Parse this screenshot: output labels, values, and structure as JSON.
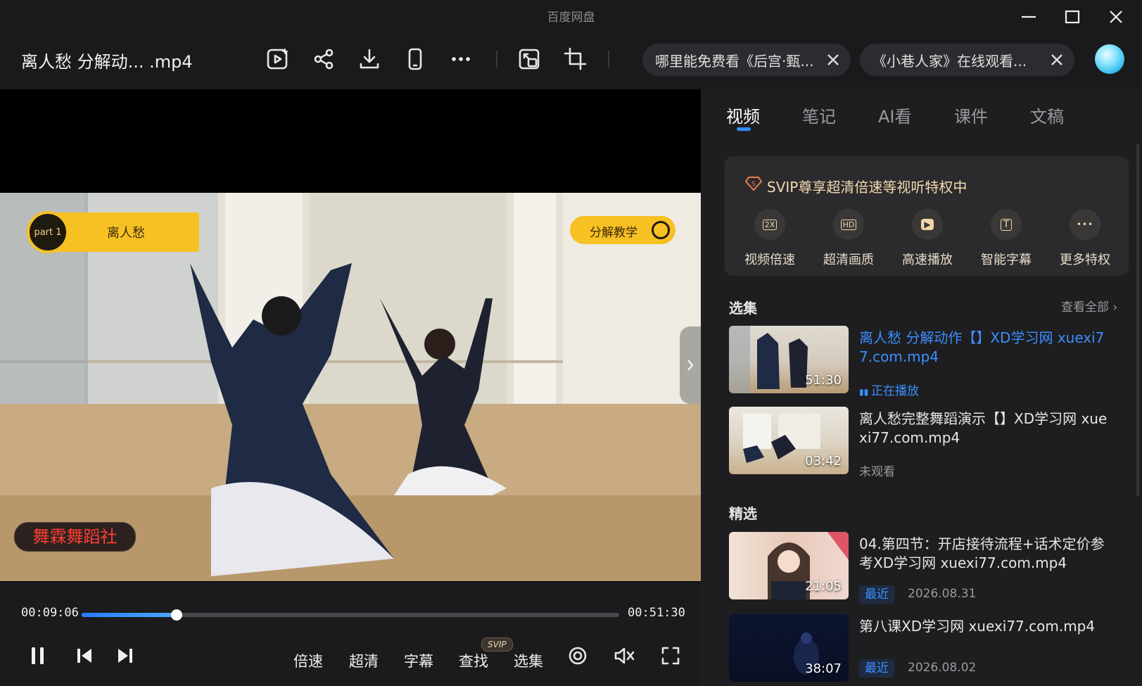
{
  "window": {
    "title": "百度网盘"
  },
  "file": {
    "title": "离人愁 分解动... .mp4"
  },
  "toolbar": {
    "icons": [
      "play-add-icon",
      "share-icon",
      "download-icon",
      "phone-icon",
      "more-icon",
      "screen-cast-icon",
      "crop-icon"
    ]
  },
  "browser_tabs": [
    {
      "label": "哪里能免费看《后宫·甄..."
    },
    {
      "label": "《小巷人家》在线观看..."
    }
  ],
  "video": {
    "overlay_part": "part 1",
    "overlay_title": "离人愁",
    "overlay_right": "分解教学",
    "watermark": "舞霖舞蹈社"
  },
  "player": {
    "current_time": "00:09:06",
    "total_time": "00:51:30",
    "progress": 0.1767,
    "speed_label": "倍速",
    "quality_label": "超清",
    "subtitle_label": "字幕",
    "search_label": "查找",
    "search_badge": "SVIP",
    "episodes_label": "选集"
  },
  "panel": {
    "tabs": [
      "视频",
      "笔记",
      "AI看",
      "课件",
      "文稿"
    ],
    "active_tab": 0,
    "svip": {
      "title": "SVIP尊享超清倍速等视听特权中",
      "perks": [
        {
          "label": "视频倍速",
          "icon": "speed-2x-icon",
          "glyph": "2X"
        },
        {
          "label": "超清画质",
          "icon": "hd-icon",
          "glyph": "HD"
        },
        {
          "label": "高速播放",
          "icon": "fast-play-icon",
          "glyph": "▶"
        },
        {
          "label": "智能字幕",
          "icon": "smart-subtitle-icon",
          "glyph": "T"
        },
        {
          "label": "更多特权",
          "icon": "more-perks-icon",
          "glyph": "•••"
        }
      ]
    },
    "episodes": {
      "title": "选集",
      "view_all": "查看全部",
      "items": [
        {
          "name": "离人愁 分解动作【】XD学习网 xuexi77.com.mp4",
          "duration": "51:30",
          "status": "正在播放"
        },
        {
          "name": "离人愁完整舞蹈演示【】XD学习网 xuexi77.com.mp4",
          "duration": "03:42",
          "status": "未观看"
        }
      ]
    },
    "featured": {
      "title": "精选",
      "items": [
        {
          "name": "04.第四节：开店接待流程+话术定价参考XD学习网 xuexi77.com.mp4",
          "duration": "21:05",
          "tag": "最近",
          "date": "2026.08.31"
        },
        {
          "name": "第八课XD学习网 xuexi77.com.mp4",
          "duration": "38:07",
          "tag": "最近",
          "date": "2026.08.02"
        }
      ]
    }
  },
  "colors": {
    "accent": "#2f8cff",
    "svip_gold": "#f3d8ad",
    "bg": "#1a1a1c"
  }
}
